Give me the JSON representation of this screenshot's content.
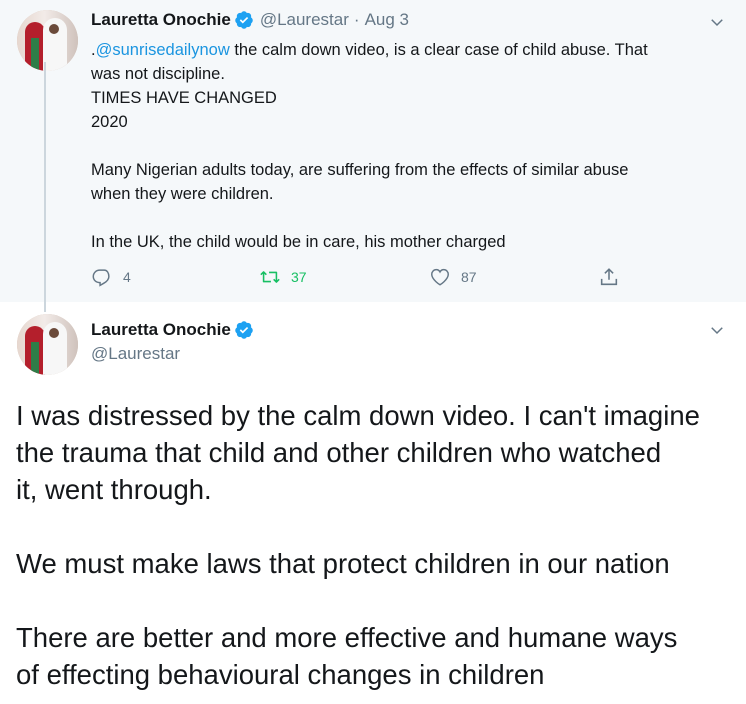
{
  "parent_tweet": {
    "display_name": "Lauretta Onochie",
    "handle": "@Laurestar",
    "separator": "·",
    "date": "Aug 3",
    "mention": "@sunrisedailynow",
    "lines": [
      " the calm down video, is a clear case of child abuse. That",
      "was not discipline.",
      "TIMES HAVE CHANGED",
      "2020",
      "",
      "Many Nigerian adults today, are suffering from the effects of similar abuse",
      "when they were children.",
      "",
      "In the UK, the child would be in care, his mother charged"
    ],
    "mention_prefix": ".",
    "actions": {
      "reply_count": "4",
      "retweet_count": "37",
      "like_count": "87"
    }
  },
  "main_tweet": {
    "display_name": "Lauretta Onochie",
    "handle": "@Laurestar",
    "lines": [
      "I was distressed by the calm down video. I can't imagine",
      "the trauma that child and other children who watched",
      "it, went through.",
      "",
      "We must make laws that protect children in our nation",
      "",
      "There are better and more effective and humane ways",
      "of effecting behavioural changes in children"
    ]
  },
  "icons": {
    "verified": "verified-badge-icon",
    "chevron": "chevron-down-icon",
    "reply": "reply-icon",
    "retweet": "retweet-icon",
    "like": "heart-icon",
    "share": "share-icon"
  },
  "colors": {
    "verified": "#1da1f2",
    "link": "#1b95e0",
    "retweet_active": "#17bf63",
    "muted": "#657786",
    "parent_bg": "#f5f8fa"
  }
}
